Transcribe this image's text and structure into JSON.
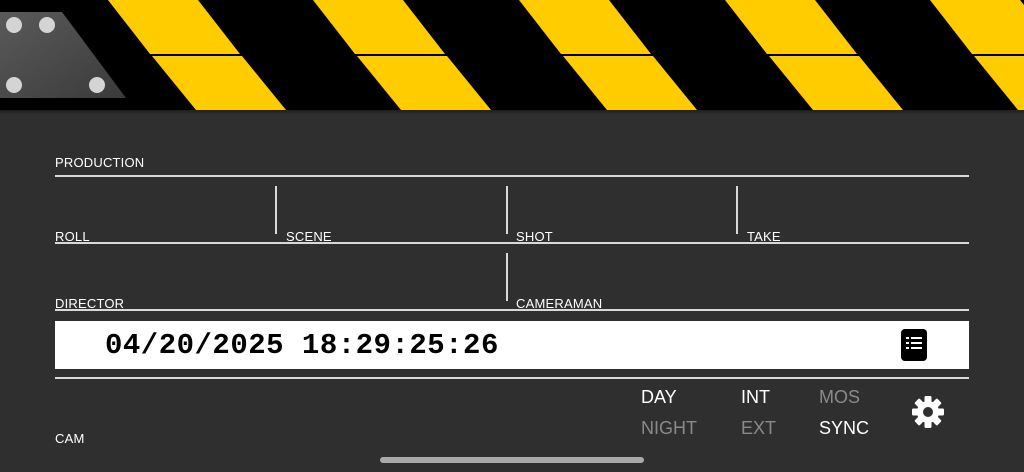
{
  "fields": {
    "production": "PRODUCTION",
    "roll": "ROLL",
    "scene": "SCENE",
    "shot": "SHOT",
    "take": "TAKE",
    "director": "DIRECTOR",
    "cameraman": "CAMERAMAN",
    "cam": "CAM"
  },
  "timecode": "04/20/2025 18:29:25:26",
  "toggles": {
    "day": "DAY",
    "night": "NIGHT",
    "int": "INT",
    "ext": "EXT",
    "mos": "MOS",
    "sync": "SYNC"
  },
  "toggle_state": {
    "day": true,
    "night": false,
    "int": true,
    "ext": false,
    "mos": false,
    "sync": true
  },
  "colors": {
    "stripe": "#FFCC00",
    "background": "#2F2F2F",
    "inactive": "#8A8A8A"
  },
  "icons": {
    "notes": "notes-icon",
    "settings": "gear-icon"
  }
}
